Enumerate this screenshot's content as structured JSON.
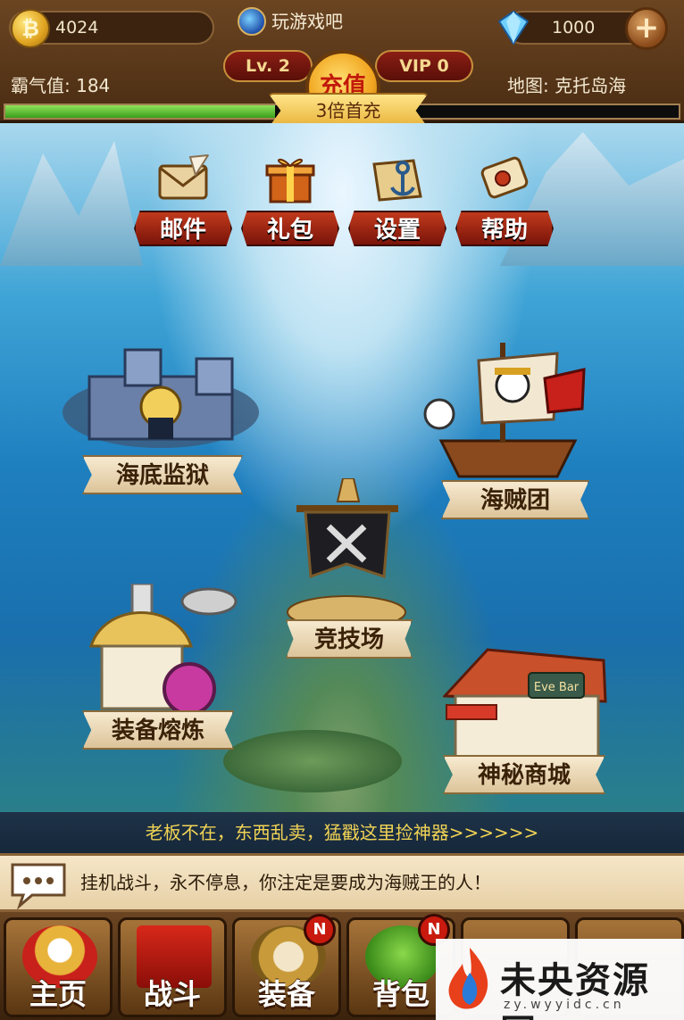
{
  "hud": {
    "coins": "4024",
    "coin_symbol": "₿",
    "site_name": "玩游戏吧",
    "gems": "1000",
    "plus": "+",
    "level": "Lv. 2",
    "vip": "VIP 0",
    "recharge_label": "充值",
    "power_label": "霸气值: 184",
    "map_label": "地图: 克托岛海",
    "first_charge": "3倍首充",
    "exp_progress": 0.4
  },
  "menu": [
    {
      "label": "邮件",
      "icon": "mail-icon"
    },
    {
      "label": "礼包",
      "icon": "gift-icon"
    },
    {
      "label": "设置",
      "icon": "settings-icon"
    },
    {
      "label": "帮助",
      "icon": "help-icon"
    }
  ],
  "buildings": {
    "prison": "海底监狱",
    "pirates": "海贼团",
    "arena": "竞技场",
    "smelt": "装备熔炼",
    "shop": "神秘商城",
    "shop_sign": "Eve Bar"
  },
  "news": "老板不在，东西乱卖，猛戳这里捡神器>>>>>>",
  "chat": "挂机战斗，永不停息，你注定是要成为海贼王的人！",
  "nav": [
    {
      "label": "主页",
      "badge": ""
    },
    {
      "label": "战斗",
      "badge": ""
    },
    {
      "label": "装备",
      "badge": "N"
    },
    {
      "label": "背包",
      "badge": "N"
    }
  ],
  "watermark": {
    "title": "未央资源网",
    "sub": "zy.wyyidc.cn"
  },
  "colors": {
    "accent_red": "#c21a0a",
    "gold": "#e8b33a",
    "progress_green": "#3a9e1a"
  }
}
